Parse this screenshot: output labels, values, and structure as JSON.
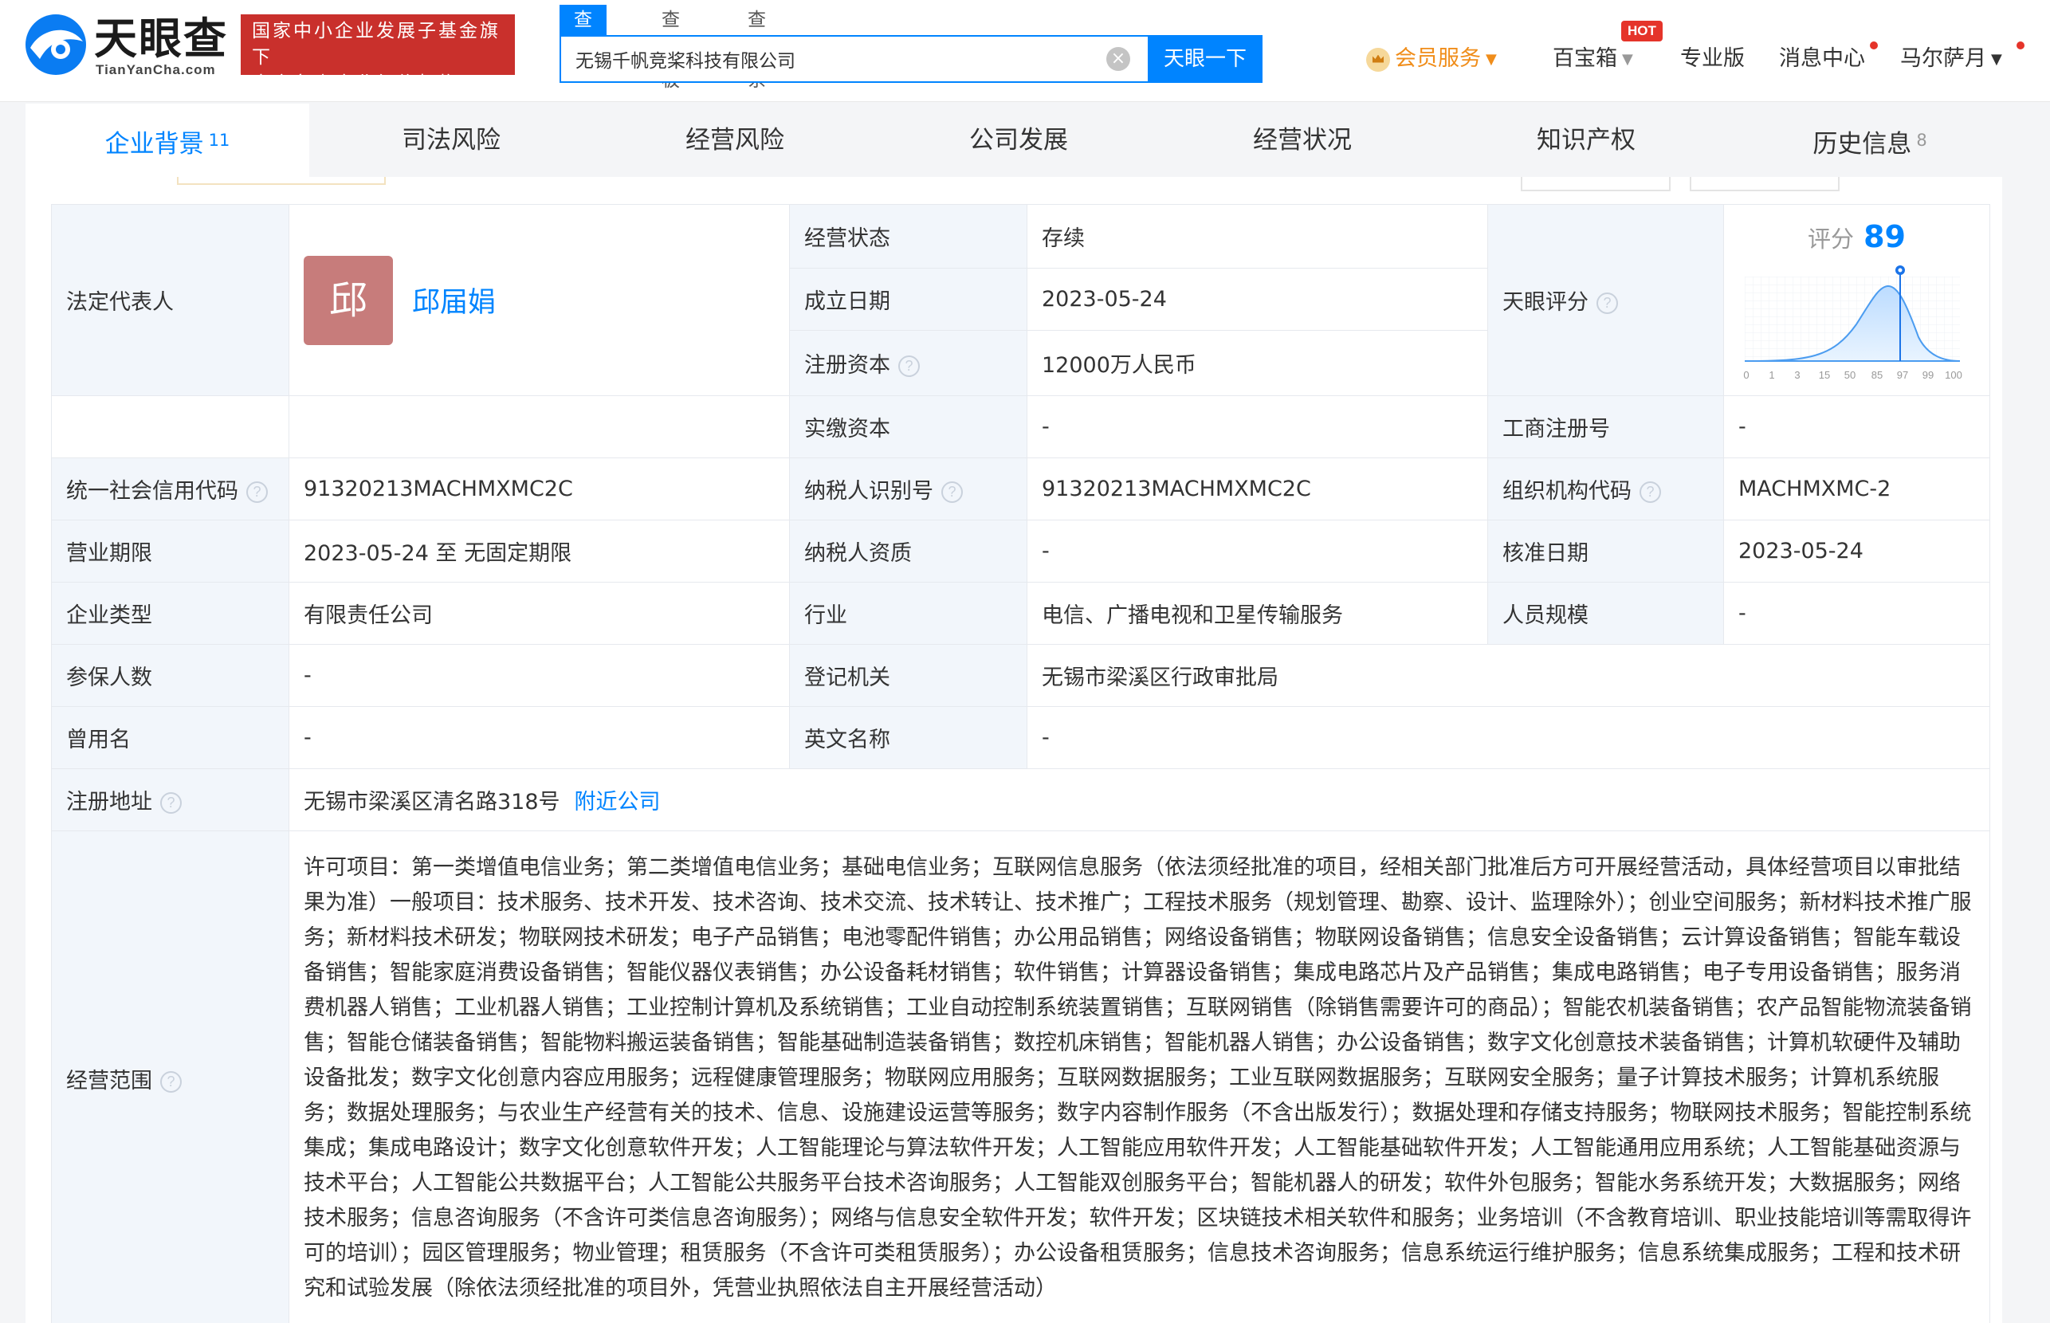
{
  "header": {
    "logo_text": "天眼查",
    "logo_domain": "TianYanCha.com",
    "banner_line1": "国家中小企业发展子基金旗下",
    "banner_line2": "官方备案企业征信机构",
    "search_tabs": [
      "查公司",
      "查老板",
      "查关系"
    ],
    "search_value": "无锡千帆竞桨科技有限公司",
    "search_button": "天眼一下",
    "nav": {
      "vip": "会员服务",
      "baibaoxiang": "百宝箱",
      "hot": "HOT",
      "pro": "专业版",
      "messages": "消息中心",
      "user": "马尔萨月"
    }
  },
  "tabs": [
    {
      "label": "企业背景",
      "count": "11"
    },
    {
      "label": "司法风险",
      "count": ""
    },
    {
      "label": "经营风险",
      "count": ""
    },
    {
      "label": "公司发展",
      "count": ""
    },
    {
      "label": "经营状况",
      "count": ""
    },
    {
      "label": "知识产权",
      "count": ""
    },
    {
      "label": "历史信息",
      "count": "8"
    }
  ],
  "info": {
    "legal_rep_label": "法定代表人",
    "legal_rep_avatar": "邱",
    "legal_rep_name": "邱届娟",
    "status_label": "经营状态",
    "status_value": "存续",
    "found_date_label": "成立日期",
    "found_date_value": "2023-05-24",
    "reg_capital_label": "注册资本",
    "reg_capital_value": "12000万人民币",
    "paid_capital_label": "实缴资本",
    "paid_capital_value": "-",
    "score_label": "天眼评分",
    "score_title": "评分",
    "score_value": "89",
    "biz_reg_no_label": "工商注册号",
    "biz_reg_no_value": "-",
    "credit_code_label": "统一社会信用代码",
    "credit_code_value": "91320213MACHMXMC2C",
    "taxpayer_id_label": "纳税人识别号",
    "taxpayer_id_value": "91320213MACHMXMC2C",
    "org_code_label": "组织机构代码",
    "org_code_value": "MACHMXMC-2",
    "term_label": "营业期限",
    "term_value": "2023-05-24 至 无固定期限",
    "taxpayer_qual_label": "纳税人资质",
    "taxpayer_qual_value": "-",
    "approve_date_label": "核准日期",
    "approve_date_value": "2023-05-24",
    "type_label": "企业类型",
    "type_value": "有限责任公司",
    "industry_label": "行业",
    "industry_value": "电信、广播电视和卫星传输服务",
    "staff_label": "人员规模",
    "staff_value": "-",
    "insured_label": "参保人数",
    "insured_value": "-",
    "authority_label": "登记机关",
    "authority_value": "无锡市梁溪区行政审批局",
    "former_name_label": "曾用名",
    "former_name_value": "-",
    "english_name_label": "英文名称",
    "english_name_value": "-",
    "address_label": "注册地址",
    "address_value": "无锡市梁溪区清名路318号",
    "nearby_link": "附近公司",
    "scope_label": "经营范围",
    "scope_value": "许可项目：第一类增值电信业务；第二类增值电信业务；基础电信业务；互联网信息服务（依法须经批准的项目，经相关部门批准后方可开展经营活动，具体经营项目以审批结果为准）一般项目：技术服务、技术开发、技术咨询、技术交流、技术转让、技术推广；工程技术服务（规划管理、勘察、设计、监理除外）；创业空间服务；新材料技术推广服务；新材料技术研发；物联网技术研发；电子产品销售；电池零配件销售；办公用品销售；网络设备销售；物联网设备销售；信息安全设备销售；云计算设备销售；智能车载设备销售；智能家庭消费设备销售；智能仪器仪表销售；办公设备耗材销售；软件销售；计算器设备销售；集成电路芯片及产品销售；集成电路销售；电子专用设备销售；服务消费机器人销售；工业机器人销售；工业控制计算机及系统销售；工业自动控制系统装置销售；互联网销售（除销售需要许可的商品）；智能农机装备销售；农产品智能物流装备销售；智能仓储装备销售；智能物料搬运装备销售；智能基础制造装备销售；数控机床销售；智能机器人销售；办公设备销售；数字文化创意技术装备销售；计算机软硬件及辅助设备批发；数字文化创意内容应用服务；远程健康管理服务；物联网应用服务；互联网数据服务；工业互联网数据服务；互联网安全服务；量子计算技术服务；计算机系统服务；数据处理服务；与农业生产经营有关的技术、信息、设施建设运营等服务；数字内容制作服务（不含出版发行）；数据处理和存储支持服务；物联网技术服务；智能控制系统集成；集成电路设计；数字文化创意软件开发；人工智能理论与算法软件开发；人工智能应用软件开发；人工智能基础软件开发；人工智能通用应用系统；人工智能基础资源与技术平台；人工智能公共数据平台；人工智能公共服务平台技术咨询服务；人工智能双创服务平台；智能机器人的研发；软件外包服务；智能水务系统开发；大数据服务；网络技术服务；信息咨询服务（不含许可类信息咨询服务）；网络与信息安全软件开发；软件开发；区块链技术相关软件和服务；业务培训（不含教育培训、职业技能培训等需取得许可的培训）；园区管理服务；物业管理；租赁服务（不含许可类租赁服务）；办公设备租赁服务；信息技术咨询服务；信息系统运行维护服务；信息系统集成服务；工程和技术研究和试验发展（除依法须经批准的项目外，凭营业执照依法自主开展经营活动）"
  },
  "score_chart": {
    "x_ticks": [
      "0",
      "1",
      "3",
      "15",
      "50",
      "85",
      "97",
      "99",
      "100"
    ],
    "marker": "89"
  },
  "colors": {
    "accent": "#0084ff",
    "banner_red": "#c9302c",
    "vip_orange": "#f08d1a",
    "label_bg": "#f2f6fb",
    "avatar_bg": "#c77c7b"
  }
}
